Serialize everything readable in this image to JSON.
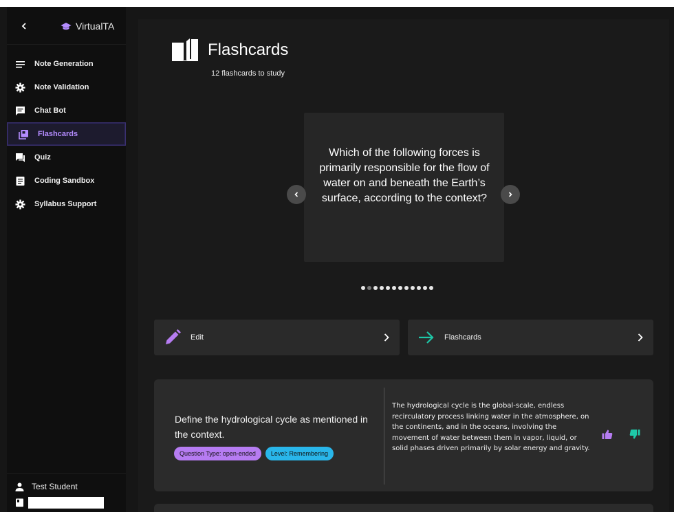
{
  "sidebar": {
    "brand": "VirtualTA",
    "items": [
      {
        "label": "Note Generation",
        "icon": "lines-icon"
      },
      {
        "label": "Note Validation",
        "icon": "gear-icon"
      },
      {
        "label": "Chat Bot",
        "icon": "chat-icon"
      },
      {
        "label": "Flashcards",
        "icon": "flashcards-icon",
        "active": true
      },
      {
        "label": "Quiz",
        "icon": "quiz-icon"
      },
      {
        "label": "Coding Sandbox",
        "icon": "document-icon"
      },
      {
        "label": "Syllabus Support",
        "icon": "gear-icon"
      }
    ],
    "user_name": "Test Student"
  },
  "header": {
    "title": "Flashcards",
    "subtitle": "12 flashcards to study"
  },
  "carousel": {
    "question": "Which of the following forces is primarily responsible for the flow of water on and beneath the Earth’s surface, according to the context?",
    "total": 12,
    "active_index": 1
  },
  "actions": {
    "edit_label": "Edit",
    "flashcards_label": "Flashcards"
  },
  "qa": {
    "question": "Define the hydrological cycle as mentioned in the context.",
    "type_tag": "Question Type: open-ended",
    "level_tag": "Level: Remembering",
    "answer": "The hydrological cycle is the global-scale, endless recirculatory process linking water in the atmosphere, on the continents, and in the oceans, involving the movement of water between them in vapor, liquid, or solid phases driven primarily by solar energy and gravity."
  },
  "colors": {
    "accent_purple": "#b67cf2",
    "accent_blue": "#29b6ea",
    "accent_teal": "#1ec8a8",
    "sidebar_active": "#b48cff"
  }
}
